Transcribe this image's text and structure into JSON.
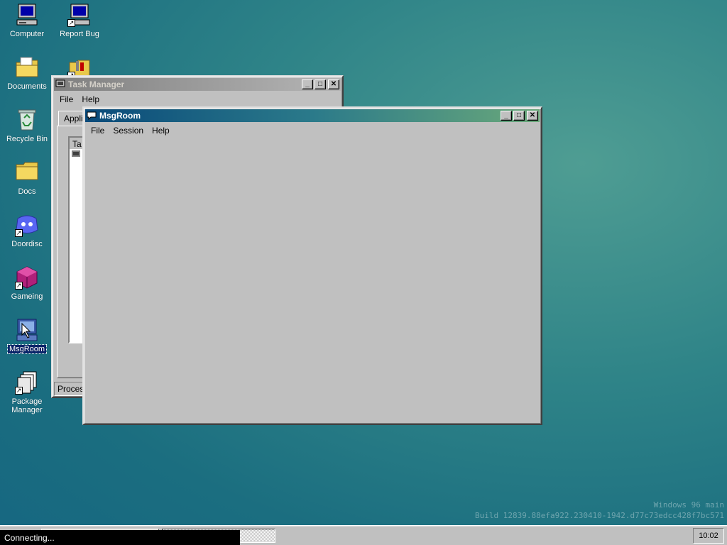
{
  "desktop": {
    "icons": [
      {
        "label": "Computer",
        "name": "computer-icon"
      },
      {
        "label": "Report Bug",
        "name": "report-bug-icon"
      },
      {
        "label": "Documents",
        "name": "documents-folder-icon"
      },
      {
        "label": "",
        "name": "tools-folder-icon"
      },
      {
        "label": "Recycle Bin",
        "name": "recycle-bin-icon"
      },
      {
        "label": "Docs",
        "name": "docs-folder-icon"
      },
      {
        "label": "Doordisc",
        "name": "doordisc-icon"
      },
      {
        "label": "Gameing",
        "name": "gameing-icon"
      },
      {
        "label": "MsgRoom",
        "name": "msgroom-icon"
      },
      {
        "label": "Package Manager",
        "name": "package-manager-icon"
      }
    ]
  },
  "task_manager": {
    "title": "Task Manager",
    "menu": [
      "File",
      "Help"
    ],
    "tab_partial": "Appli",
    "column_partial": "Ta",
    "status_partial": "Process"
  },
  "msgroom": {
    "title": "MsgRoom",
    "menu": [
      "File",
      "Session",
      "Help"
    ]
  },
  "watermark": {
    "line1": "Windows 96 main",
    "line2": "Build 12839.88efa922.230410-1942.d77c73edcc428f7bc571"
  },
  "taskbar": {
    "clock": "10:02",
    "status": "Connecting..."
  },
  "colors": {
    "desktop": "#1b6e80",
    "window": "#c0c0c0",
    "selection": "#0a246a"
  }
}
